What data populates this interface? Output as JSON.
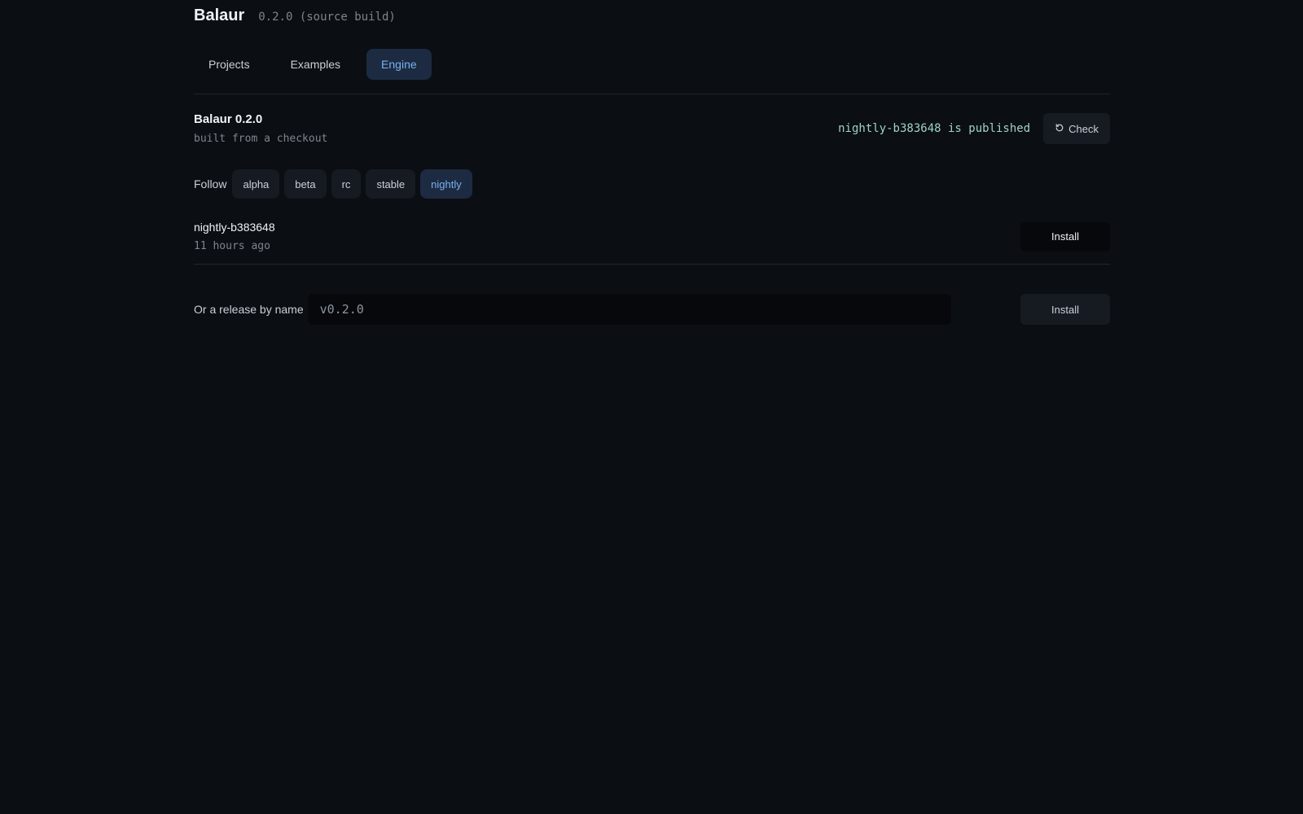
{
  "header": {
    "title": "Balaur",
    "version": "0.2.0 (source build)"
  },
  "tabs": [
    {
      "label": "Projects",
      "active": false
    },
    {
      "label": "Examples",
      "active": false
    },
    {
      "label": "Engine",
      "active": true
    }
  ],
  "engine": {
    "name": "Balaur 0.2.0",
    "subtitle": "built from a checkout",
    "published_status": "nightly-b383648 is published",
    "check_label": "Check",
    "check_icon": "refresh-icon"
  },
  "follow": {
    "label": "Follow",
    "channels": [
      {
        "label": "alpha",
        "active": false
      },
      {
        "label": "beta",
        "active": false
      },
      {
        "label": "rc",
        "active": false
      },
      {
        "label": "stable",
        "active": false
      },
      {
        "label": "nightly",
        "active": true
      }
    ]
  },
  "release": {
    "name": "nightly-b383648",
    "time": "11 hours ago",
    "install_label": "Install"
  },
  "by_name": {
    "label": "Or a release by name",
    "placeholder": "v0.2.0",
    "value": "",
    "install_label": "Install"
  },
  "colors": {
    "background": "#0b0e13",
    "accent": "#79b0f0",
    "accent_bg": "#1c2b41",
    "published": "#9fd3c7"
  }
}
